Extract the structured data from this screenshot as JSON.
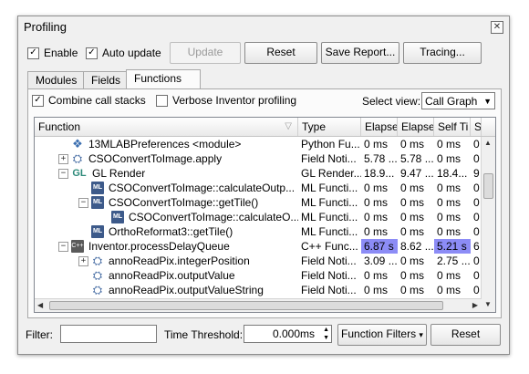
{
  "window": {
    "title": "Profiling",
    "close_glyph": "✕"
  },
  "toolbar": {
    "enable_label": "Enable",
    "auto_update_label": "Auto update",
    "update_label": "Update",
    "reset_label": "Reset",
    "save_report_label": "Save Report...",
    "tracing_label": "Tracing..."
  },
  "tabs": [
    {
      "label": "Modules",
      "active": false
    },
    {
      "label": "Fields",
      "active": false
    },
    {
      "label": "Functions",
      "active": true
    }
  ],
  "options": {
    "combine_label": "Combine call stacks",
    "verbose_label": "Verbose Inventor profiling",
    "select_view_label": "Select view:",
    "select_view_value": "Call Graph"
  },
  "columns": [
    "Function",
    "Type",
    "Elapse",
    "Elapse",
    "Self Ti",
    "S"
  ],
  "rows": [
    {
      "name": "13MLABPreferences <module>",
      "type": "Python Fu...",
      "c1": "0 ms",
      "c2": "0 ms",
      "c3": "0 ms",
      "c4": "0 ms",
      "icon": "python-icon"
    },
    {
      "name": "CSOConvertToImage.apply",
      "type": "Field Noti...",
      "c1": "5.78 ...",
      "c2": "5.78 ...",
      "c3": "0 ms",
      "c4": "0 ms",
      "icon": "field-icon"
    },
    {
      "name": "GL Render",
      "type": "GL Render...",
      "c1": "18.9...",
      "c2": "9.47 ...",
      "c3": "18.4...",
      "c4": "9",
      "icon": "gl-icon"
    },
    {
      "name": "CSOConvertToImage::calculateOutp...",
      "type": "ML Functi...",
      "c1": "0 ms",
      "c2": "0 ms",
      "c3": "0 ms",
      "c4": "0",
      "icon": "ml-icon"
    },
    {
      "name": "CSOConvertToImage::getTile()",
      "type": "ML Functi...",
      "c1": "0 ms",
      "c2": "0 ms",
      "c3": "0 ms",
      "c4": "0",
      "icon": "ml-icon"
    },
    {
      "name": "CSOConvertToImage::calculateO...",
      "type": "ML Functi...",
      "c1": "0 ms",
      "c2": "0 ms",
      "c3": "0 ms",
      "c4": "0",
      "icon": "ml-icon"
    },
    {
      "name": "OrthoReformat3::getTile()",
      "type": "ML Functi...",
      "c1": "0 ms",
      "c2": "0 ms",
      "c3": "0 ms",
      "c4": "0",
      "icon": "ml-icon"
    },
    {
      "name": "Inventor.processDelayQueue",
      "type": "C++ Func...",
      "c1": "6.87 s",
      "c2": "8.62 ...",
      "c3": "5.21 s",
      "c4": "6",
      "icon": "cpp-icon"
    },
    {
      "name": "annoReadPix.integerPosition",
      "type": "Field Noti...",
      "c1": "3.09 ...",
      "c2": "0 ms",
      "c3": "2.75 ...",
      "c4": "0",
      "icon": "field-icon"
    },
    {
      "name": "annoReadPix.outputValue",
      "type": "Field Noti...",
      "c1": "0 ms",
      "c2": "0 ms",
      "c3": "0 ms",
      "c4": "0",
      "icon": "field-icon"
    },
    {
      "name": "annoReadPix.outputValueString",
      "type": "Field Noti...",
      "c1": "0 ms",
      "c2": "0 ms",
      "c3": "0 ms",
      "c4": "0",
      "icon": "field-icon"
    }
  ],
  "bottom": {
    "filter_label": "Filter:",
    "filter_value": "",
    "threshold_label": "Time Threshold:",
    "threshold_value": "0.000ms",
    "function_filters_label": "Function Filters",
    "reset_label": "Reset"
  }
}
